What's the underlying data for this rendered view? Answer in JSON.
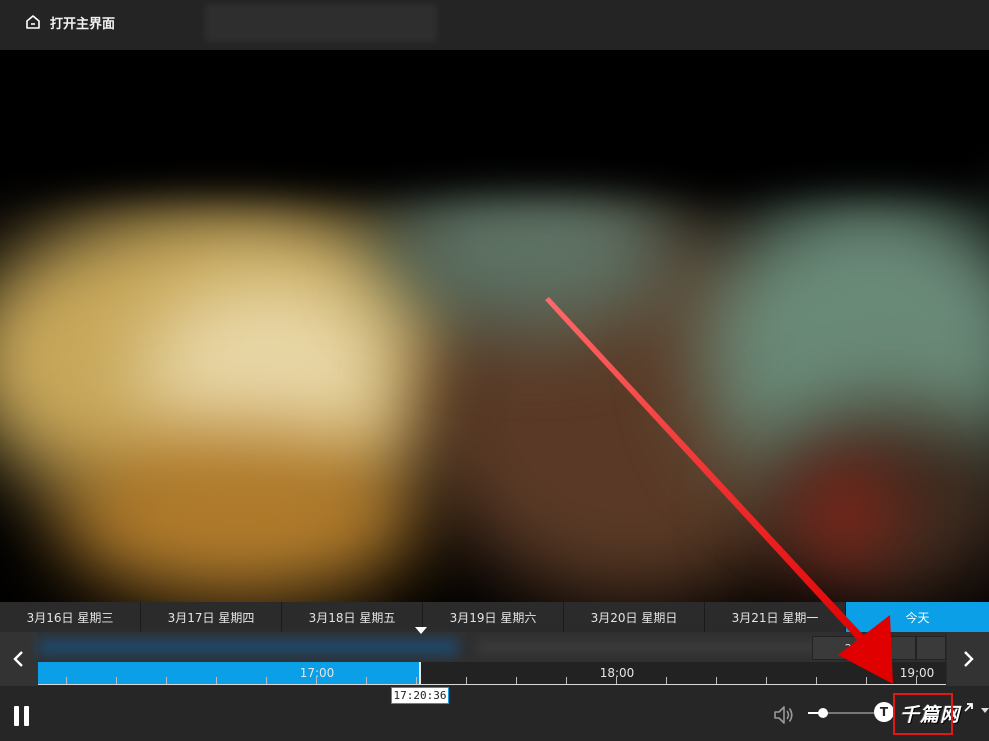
{
  "topbar": {
    "home_label": "打开主界面"
  },
  "day_tabs": [
    {
      "label": "3月16日 星期三"
    },
    {
      "label": "3月17日 星期四"
    },
    {
      "label": "3月18日 星期五"
    },
    {
      "label": "3月19日 星期六"
    },
    {
      "label": "3月20日 星期日"
    },
    {
      "label": "3月21日 星期一"
    },
    {
      "label": "今天"
    }
  ],
  "timeline": {
    "date_chip": "2022···",
    "hours": [
      "17:00",
      "18:00",
      "19:00"
    ],
    "current_time": "17:20:36"
  },
  "controls": {
    "logo_badge": "T",
    "watermark": "千篇网"
  },
  "colors": {
    "accent": "#0a9fe6",
    "annotation": "#e01818"
  },
  "icons": [
    "home-icon",
    "chevron-left-icon",
    "chevron-right-icon",
    "pause-icon",
    "volume-icon",
    "fullscreen-icon"
  ]
}
